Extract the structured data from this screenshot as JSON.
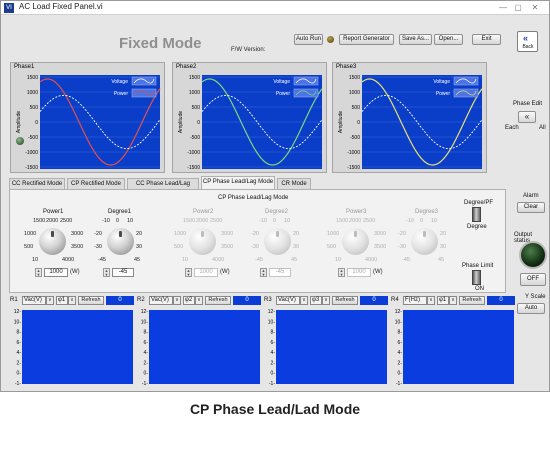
{
  "window": {
    "title": "AC Load Fixed Panel.vi",
    "minimize": "—",
    "maximize": "▢",
    "close": "✕",
    "app_icon": "VI"
  },
  "header": {
    "mode_title": "Fixed Mode",
    "fw_label": "F/W Version:"
  },
  "toolbar": {
    "auto_run": "Auto Run",
    "report_generator": "Report Generator",
    "save_as": "Save As...",
    "open": "Open...",
    "exit": "Exit"
  },
  "back": {
    "label": "Back",
    "icon": "double-left-arrow-icon"
  },
  "phase_graphs": [
    {
      "name": "Phase1",
      "y_axis_label": "Amplitude",
      "legend": [
        "Voltage",
        "Power"
      ],
      "y_ticks": [
        "1500",
        "1000",
        "500",
        "0",
        "-500",
        "-1000",
        "-1500"
      ],
      "power_color": "#e05050"
    },
    {
      "name": "Phase2",
      "y_axis_label": "Amplitude",
      "legend": [
        "Voltage",
        "Power"
      ],
      "y_ticks": [
        "1500",
        "1000",
        "500",
        "0",
        "-500",
        "-1000",
        "-1500"
      ],
      "power_color": "#7ed67e"
    },
    {
      "name": "Phase3",
      "y_axis_label": "Amplitude",
      "legend": [
        "Voltage",
        "Power"
      ],
      "y_ticks": [
        "1500",
        "1000",
        "500",
        "0",
        "-500",
        "-1000",
        "-1500"
      ],
      "power_color": "#e8e070"
    }
  ],
  "tabs": [
    "CC Rectified Mode",
    "CP Rectified Mode",
    "CC Phase Lead/Lag Mode",
    "CP Phase Lead/Lag Mode",
    "CR Mode"
  ],
  "active_tab": "CP Phase Lead/Lag Mode",
  "panel": {
    "title": "CP Phase Lead/Lag Mode",
    "power_labels": [
      "Power1",
      "Power2",
      "Power3"
    ],
    "degree_labels": [
      "Degree1",
      "Degree2",
      "Degree3"
    ],
    "power_ticks": [
      "1500",
      "2000",
      "2500",
      "1000",
      "3000",
      "500",
      "3500",
      "10",
      "4000"
    ],
    "degree_ticks": [
      "-10",
      "0",
      "10",
      "-20",
      "20",
      "-30",
      "30",
      "-45",
      "45"
    ],
    "power_values": [
      "1000",
      "1000",
      "1000"
    ],
    "degree_values": [
      "-45",
      "-45",
      "-45"
    ],
    "power_unit": "(W)",
    "degree_pf_label": "Degree/PF",
    "degree_pf_value": "Degree",
    "phase_limit_label": "Phase Limit",
    "phase_limit_value": "ON"
  },
  "phase_edit": {
    "label": "Phase Edit",
    "left": "Each",
    "right": "All"
  },
  "alarm": {
    "label": "Alarm",
    "clear": "Clear"
  },
  "output": {
    "label": "Output status",
    "off": "OFF"
  },
  "y_scale": {
    "label": "Y Scale",
    "value": "Auto"
  },
  "mini_charts": [
    {
      "row": "R1",
      "measure": "Vac(V)",
      "phase": "φ1",
      "refresh": "Refresh",
      "value": "0"
    },
    {
      "row": "R2",
      "measure": "Vac(V)",
      "phase": "φ2",
      "refresh": "Refresh",
      "value": "0"
    },
    {
      "row": "R3",
      "measure": "Vac(V)",
      "phase": "φ3",
      "refresh": "Refresh",
      "value": "0"
    },
    {
      "row": "R4",
      "measure": "F(Hz)",
      "phase": "φ1",
      "refresh": "Refresh",
      "value": "0"
    }
  ],
  "mini_y_ticks": [
    "12-",
    "10-",
    "8-",
    "6-",
    "4-",
    "2-",
    "0-",
    "-1-"
  ],
  "caption": "CP Phase Lead/Lad Mode"
}
